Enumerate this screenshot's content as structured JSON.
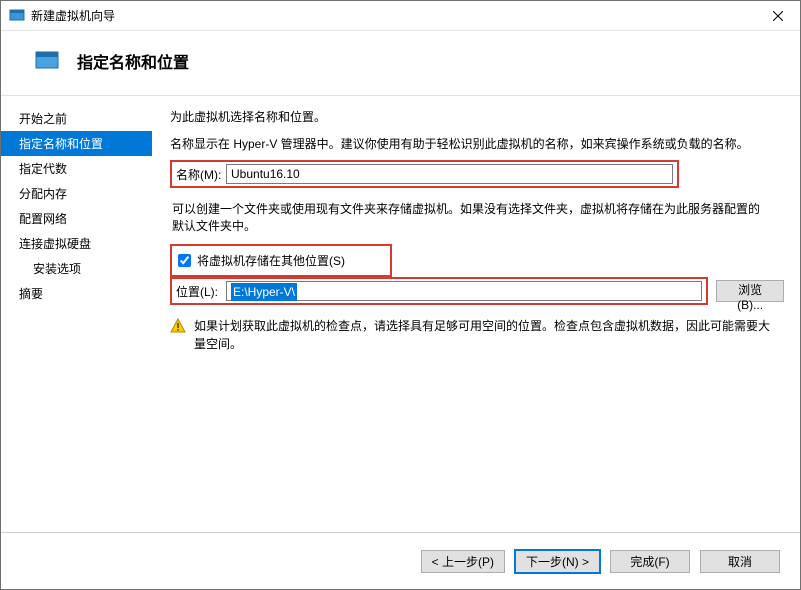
{
  "window": {
    "title": "新建虚拟机向导"
  },
  "header": {
    "title": "指定名称和位置"
  },
  "sidebar": {
    "items": [
      {
        "label": "开始之前"
      },
      {
        "label": "指定名称和位置"
      },
      {
        "label": "指定代数"
      },
      {
        "label": "分配内存"
      },
      {
        "label": "配置网络"
      },
      {
        "label": "连接虚拟硬盘"
      },
      {
        "label": "安装选项"
      },
      {
        "label": "摘要"
      }
    ]
  },
  "content": {
    "intro": "为此虚拟机选择名称和位置。",
    "name_desc": "名称显示在 Hyper-V 管理器中。建议你使用有助于轻松识别此虚拟机的名称，如来宾操作系统或负载的名称。",
    "name_label": "名称(M):",
    "name_value": "Ubuntu16.10",
    "loc_desc": "可以创建一个文件夹或使用现有文件夹来存储虚拟机。如果没有选择文件夹，虚拟机将存储在为此服务器配置的默认文件夹中。",
    "store_checkbox_label": "将虚拟机存储在其他位置(S)",
    "loc_label": "位置(L):",
    "loc_value": "E:\\Hyper-V\\",
    "browse_label": "浏览(B)...",
    "warning": "如果计划获取此虚拟机的检查点，请选择具有足够可用空间的位置。检查点包含虚拟机数据，因此可能需要大量空间。"
  },
  "footer": {
    "prev": "< 上一步(P)",
    "next": "下一步(N) >",
    "finish": "完成(F)",
    "cancel": "取消"
  }
}
